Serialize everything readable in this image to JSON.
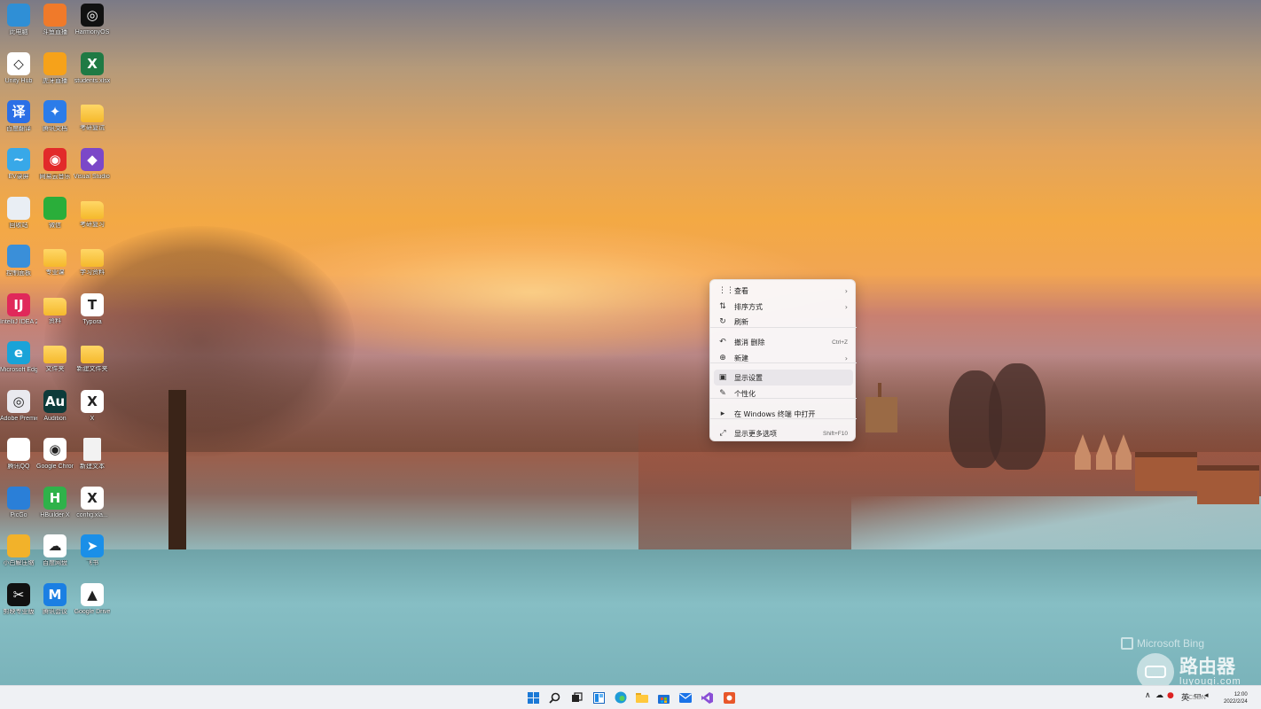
{
  "desktop_icons": [
    {
      "label": "此电脑",
      "bg": "#2f8fd6",
      "glyph": ""
    },
    {
      "label": "斗鱼直播",
      "bg": "#f07a2a",
      "glyph": ""
    },
    {
      "label": "HarmonyOS",
      "bg": "#111111",
      "glyph": "◎"
    },
    {
      "label": "Unity Hub",
      "bg": "#ffffff",
      "glyph": "◇"
    },
    {
      "label": "虎牙直播",
      "bg": "#f6a21a",
      "glyph": ""
    },
    {
      "label": "students.xlsx",
      "bg": "#1f7a44",
      "glyph": "X"
    },
    {
      "label": "百度翻译",
      "bg": "#2b6fe6",
      "glyph": "译"
    },
    {
      "label": "腾讯文档",
      "bg": "#2b7ce9",
      "glyph": "✦"
    },
    {
      "label": "考研复试",
      "bg": "folder",
      "glyph": ""
    },
    {
      "label": "EV录屏",
      "bg": "#38a8e8",
      "glyph": "~"
    },
    {
      "label": "网易云音乐",
      "bg": "#e22a2a",
      "glyph": "◉"
    },
    {
      "label": "Visual Studio 2022",
      "bg": "#7b48c8",
      "glyph": "◆"
    },
    {
      "label": "回收站",
      "bg": "#e9eef4",
      "glyph": ""
    },
    {
      "label": "微信",
      "bg": "#2aae3a",
      "glyph": ""
    },
    {
      "label": "考研复习",
      "bg": "folder",
      "glyph": ""
    },
    {
      "label": "控制面板",
      "bg": "#3a8fd9",
      "glyph": ""
    },
    {
      "label": "专业课",
      "bg": "folder",
      "glyph": ""
    },
    {
      "label": "学习资料",
      "bg": "folder",
      "glyph": ""
    },
    {
      "label": "IntelliJ IDEA 2021.3.2",
      "bg": "#e0285a",
      "glyph": "IJ"
    },
    {
      "label": "资料",
      "bg": "folder",
      "glyph": ""
    },
    {
      "label": "Typora",
      "bg": "#ffffff",
      "glyph": "T"
    },
    {
      "label": "Microsoft Edge",
      "bg": "#1aa3d8",
      "glyph": "e"
    },
    {
      "label": "文件夹",
      "bg": "folder",
      "glyph": ""
    },
    {
      "label": "新建文件夹",
      "bg": "folder",
      "glyph": ""
    },
    {
      "label": "Adobe Premiere",
      "bg": "#e9e9ef",
      "glyph": "◎"
    },
    {
      "label": "Audition",
      "bg": "#0d3b3a",
      "glyph": "Au"
    },
    {
      "label": "X",
      "bg": "#ffffff",
      "glyph": "X"
    },
    {
      "label": "腾讯QQ",
      "bg": "#ffffff",
      "glyph": ""
    },
    {
      "label": "Google Chrome",
      "bg": "#ffffff",
      "glyph": "◉"
    },
    {
      "label": "新建文本",
      "bg": "file",
      "glyph": ""
    },
    {
      "label": "PicGo",
      "bg": "#2a7fd8",
      "glyph": ""
    },
    {
      "label": "HBuilder X",
      "bg": "#2fb24a",
      "glyph": "H"
    },
    {
      "label": "config.xla...",
      "bg": "#ffffff",
      "glyph": "X"
    },
    {
      "label": "小白解压缩",
      "bg": "#f2b22a",
      "glyph": ""
    },
    {
      "label": "百度网盘",
      "bg": "#ffffff",
      "glyph": "☁"
    },
    {
      "label": "飞书",
      "bg": "#1a8fe8",
      "glyph": "➤"
    },
    {
      "label": "剪映专业版",
      "bg": "#111111",
      "glyph": "✂"
    },
    {
      "label": "腾讯会议",
      "bg": "#1b7fe3",
      "glyph": "M"
    },
    {
      "label": "Google Drive",
      "bg": "#ffffff",
      "glyph": "▲"
    }
  ],
  "context_menu": {
    "items": [
      {
        "icon": "⋮⋮",
        "label": "查看",
        "shortcut": "",
        "arrow": "›"
      },
      {
        "icon": "⇅",
        "label": "排序方式",
        "shortcut": "",
        "arrow": "›"
      },
      {
        "icon": "↻",
        "label": "刷新",
        "shortcut": "",
        "arrow": ""
      },
      {
        "icon": "↶",
        "label": "撤消 删除",
        "shortcut": "Ctrl+Z",
        "arrow": ""
      },
      {
        "icon": "⊕",
        "label": "新建",
        "shortcut": "",
        "arrow": "›"
      },
      {
        "icon": "▣",
        "label": "显示设置",
        "shortcut": "",
        "arrow": ""
      },
      {
        "icon": "✎",
        "label": "个性化",
        "shortcut": "",
        "arrow": ""
      },
      {
        "icon": "▸",
        "label": "在 Windows 终端 中打开",
        "shortcut": "",
        "arrow": ""
      },
      {
        "icon": "⤢",
        "label": "显示更多选项",
        "shortcut": "Shift+F10",
        "arrow": ""
      }
    ],
    "highlighted": "显示设置"
  },
  "watermark": {
    "bing": "Microsoft Bing",
    "site_title": "路由器",
    "site_url": "luyouqi.com"
  },
  "taskbar": {
    "tray_up": "∧",
    "ime": "英",
    "time": "12:00",
    "date": "2022/2/24",
    "csdn": "CSDN"
  }
}
